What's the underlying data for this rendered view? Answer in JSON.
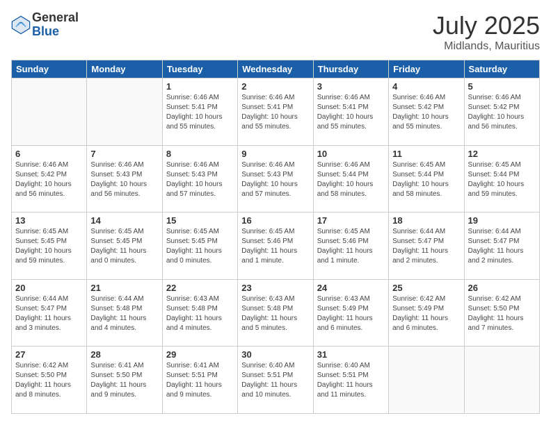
{
  "logo": {
    "general": "General",
    "blue": "Blue"
  },
  "header": {
    "month": "July 2025",
    "location": "Midlands, Mauritius"
  },
  "weekdays": [
    "Sunday",
    "Monday",
    "Tuesday",
    "Wednesday",
    "Thursday",
    "Friday",
    "Saturday"
  ],
  "weeks": [
    [
      {
        "day": "",
        "info": ""
      },
      {
        "day": "",
        "info": ""
      },
      {
        "day": "1",
        "info": "Sunrise: 6:46 AM\nSunset: 5:41 PM\nDaylight: 10 hours and 55 minutes."
      },
      {
        "day": "2",
        "info": "Sunrise: 6:46 AM\nSunset: 5:41 PM\nDaylight: 10 hours and 55 minutes."
      },
      {
        "day": "3",
        "info": "Sunrise: 6:46 AM\nSunset: 5:41 PM\nDaylight: 10 hours and 55 minutes."
      },
      {
        "day": "4",
        "info": "Sunrise: 6:46 AM\nSunset: 5:42 PM\nDaylight: 10 hours and 55 minutes."
      },
      {
        "day": "5",
        "info": "Sunrise: 6:46 AM\nSunset: 5:42 PM\nDaylight: 10 hours and 56 minutes."
      }
    ],
    [
      {
        "day": "6",
        "info": "Sunrise: 6:46 AM\nSunset: 5:42 PM\nDaylight: 10 hours and 56 minutes."
      },
      {
        "day": "7",
        "info": "Sunrise: 6:46 AM\nSunset: 5:43 PM\nDaylight: 10 hours and 56 minutes."
      },
      {
        "day": "8",
        "info": "Sunrise: 6:46 AM\nSunset: 5:43 PM\nDaylight: 10 hours and 57 minutes."
      },
      {
        "day": "9",
        "info": "Sunrise: 6:46 AM\nSunset: 5:43 PM\nDaylight: 10 hours and 57 minutes."
      },
      {
        "day": "10",
        "info": "Sunrise: 6:46 AM\nSunset: 5:44 PM\nDaylight: 10 hours and 58 minutes."
      },
      {
        "day": "11",
        "info": "Sunrise: 6:45 AM\nSunset: 5:44 PM\nDaylight: 10 hours and 58 minutes."
      },
      {
        "day": "12",
        "info": "Sunrise: 6:45 AM\nSunset: 5:44 PM\nDaylight: 10 hours and 59 minutes."
      }
    ],
    [
      {
        "day": "13",
        "info": "Sunrise: 6:45 AM\nSunset: 5:45 PM\nDaylight: 10 hours and 59 minutes."
      },
      {
        "day": "14",
        "info": "Sunrise: 6:45 AM\nSunset: 5:45 PM\nDaylight: 11 hours and 0 minutes."
      },
      {
        "day": "15",
        "info": "Sunrise: 6:45 AM\nSunset: 5:45 PM\nDaylight: 11 hours and 0 minutes."
      },
      {
        "day": "16",
        "info": "Sunrise: 6:45 AM\nSunset: 5:46 PM\nDaylight: 11 hours and 1 minute."
      },
      {
        "day": "17",
        "info": "Sunrise: 6:45 AM\nSunset: 5:46 PM\nDaylight: 11 hours and 1 minute."
      },
      {
        "day": "18",
        "info": "Sunrise: 6:44 AM\nSunset: 5:47 PM\nDaylight: 11 hours and 2 minutes."
      },
      {
        "day": "19",
        "info": "Sunrise: 6:44 AM\nSunset: 5:47 PM\nDaylight: 11 hours and 2 minutes."
      }
    ],
    [
      {
        "day": "20",
        "info": "Sunrise: 6:44 AM\nSunset: 5:47 PM\nDaylight: 11 hours and 3 minutes."
      },
      {
        "day": "21",
        "info": "Sunrise: 6:44 AM\nSunset: 5:48 PM\nDaylight: 11 hours and 4 minutes."
      },
      {
        "day": "22",
        "info": "Sunrise: 6:43 AM\nSunset: 5:48 PM\nDaylight: 11 hours and 4 minutes."
      },
      {
        "day": "23",
        "info": "Sunrise: 6:43 AM\nSunset: 5:48 PM\nDaylight: 11 hours and 5 minutes."
      },
      {
        "day": "24",
        "info": "Sunrise: 6:43 AM\nSunset: 5:49 PM\nDaylight: 11 hours and 6 minutes."
      },
      {
        "day": "25",
        "info": "Sunrise: 6:42 AM\nSunset: 5:49 PM\nDaylight: 11 hours and 6 minutes."
      },
      {
        "day": "26",
        "info": "Sunrise: 6:42 AM\nSunset: 5:50 PM\nDaylight: 11 hours and 7 minutes."
      }
    ],
    [
      {
        "day": "27",
        "info": "Sunrise: 6:42 AM\nSunset: 5:50 PM\nDaylight: 11 hours and 8 minutes."
      },
      {
        "day": "28",
        "info": "Sunrise: 6:41 AM\nSunset: 5:50 PM\nDaylight: 11 hours and 9 minutes."
      },
      {
        "day": "29",
        "info": "Sunrise: 6:41 AM\nSunset: 5:51 PM\nDaylight: 11 hours and 9 minutes."
      },
      {
        "day": "30",
        "info": "Sunrise: 6:40 AM\nSunset: 5:51 PM\nDaylight: 11 hours and 10 minutes."
      },
      {
        "day": "31",
        "info": "Sunrise: 6:40 AM\nSunset: 5:51 PM\nDaylight: 11 hours and 11 minutes."
      },
      {
        "day": "",
        "info": ""
      },
      {
        "day": "",
        "info": ""
      }
    ]
  ]
}
